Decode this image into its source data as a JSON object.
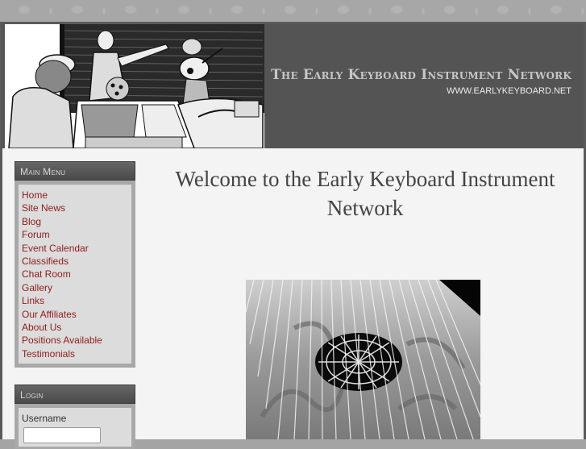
{
  "header": {
    "site_title": "The Early Keyboard Instrument Network",
    "site_url": "WWW.EARLYKEYBOARD.NET",
    "banner_image": "woodcut-musicians-with-keyboard-and-lute"
  },
  "sidebar": {
    "main_menu": {
      "title": "Main Menu",
      "items": [
        {
          "label": "Home"
        },
        {
          "label": "Site News"
        },
        {
          "label": "Blog"
        },
        {
          "label": "Forum"
        },
        {
          "label": "Event Calendar"
        },
        {
          "label": "Classifieds"
        },
        {
          "label": "Chat Room"
        },
        {
          "label": "Gallery"
        },
        {
          "label": "Links"
        },
        {
          "label": "Our Affiliates"
        },
        {
          "label": "About Us"
        },
        {
          "label": "Positions Available"
        },
        {
          "label": "Testimonials"
        }
      ]
    },
    "login": {
      "title": "Login",
      "username_label": "Username",
      "username_value": ""
    }
  },
  "main": {
    "heading": "Welcome to the Early Keyboard Instrument Network",
    "feature_image": "harpsichord-soundboard-rose-and-strings"
  },
  "colors": {
    "link": "#8e1c1c",
    "header_bg": "#545454",
    "page_bg": "#f4f4f4",
    "module_body": "#dcdcdc"
  }
}
